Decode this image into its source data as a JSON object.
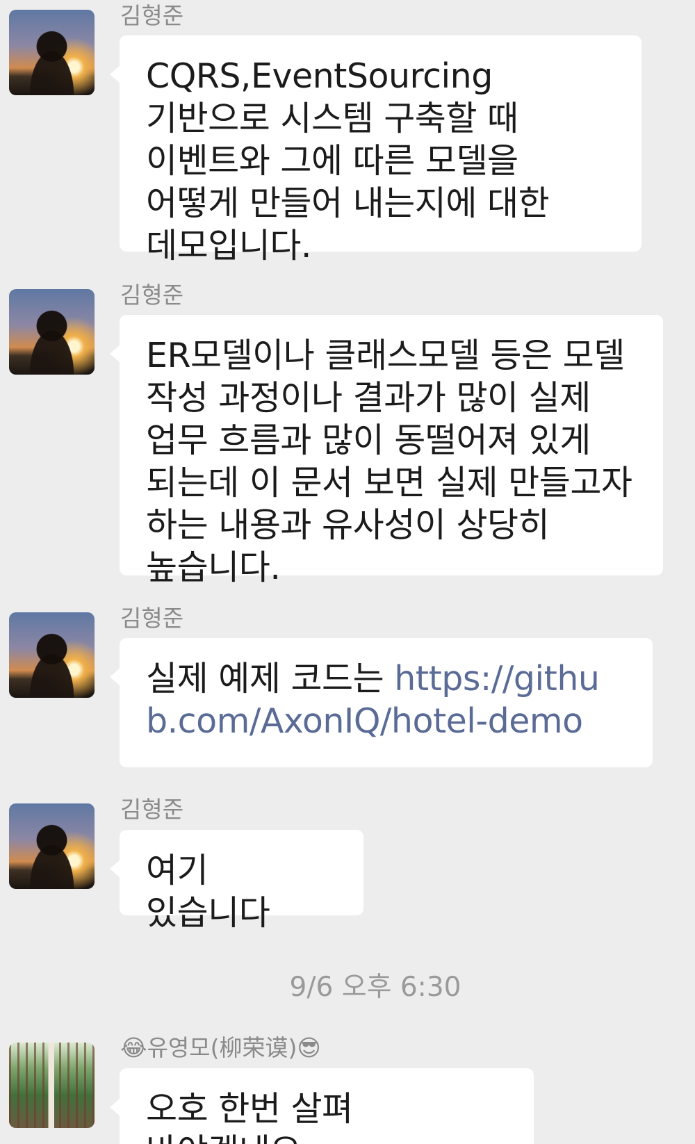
{
  "messages": [
    {
      "sender": "김형준",
      "text": "CQRS,EventSourcing 기반으로 시스템 구축할 때 이벤트와 그에 따른 모델을 어떻게 만들어 내는지에 대한 데모입니다."
    },
    {
      "sender": "김형준",
      "text": "ER모델이나 클래스모델 등은 모델 작성 과정이나 결과가 많이 실제 업무 흐름과 많이 동떨어져 있게 되는데 이 문서 보면 실제 만들고자 하는 내용과 유사성이 상당히 높습니다."
    },
    {
      "sender": "김형준",
      "text_prefix": "실제 예제 코드는 ",
      "link": "https://github.com/AxonIQ/hotel-demo"
    },
    {
      "sender": "김형준",
      "text": "여기 있습니다"
    },
    {
      "sender": "유영모(柳荣谟)",
      "sender_prefix_emoji": "😂",
      "sender_suffix_emoji": "😎",
      "text": "오호 한번 살펴 바야겠네요"
    }
  ],
  "timestamp": "9/6 오후 6:30",
  "icons": {
    "avatar_1": "sunset-avatar-icon",
    "avatar_2": "forest-bridge-avatar-icon"
  },
  "colors": {
    "background": "#ededed",
    "bubble": "#ffffff",
    "link": "#5a6b96",
    "name": "#8a8a8a"
  }
}
